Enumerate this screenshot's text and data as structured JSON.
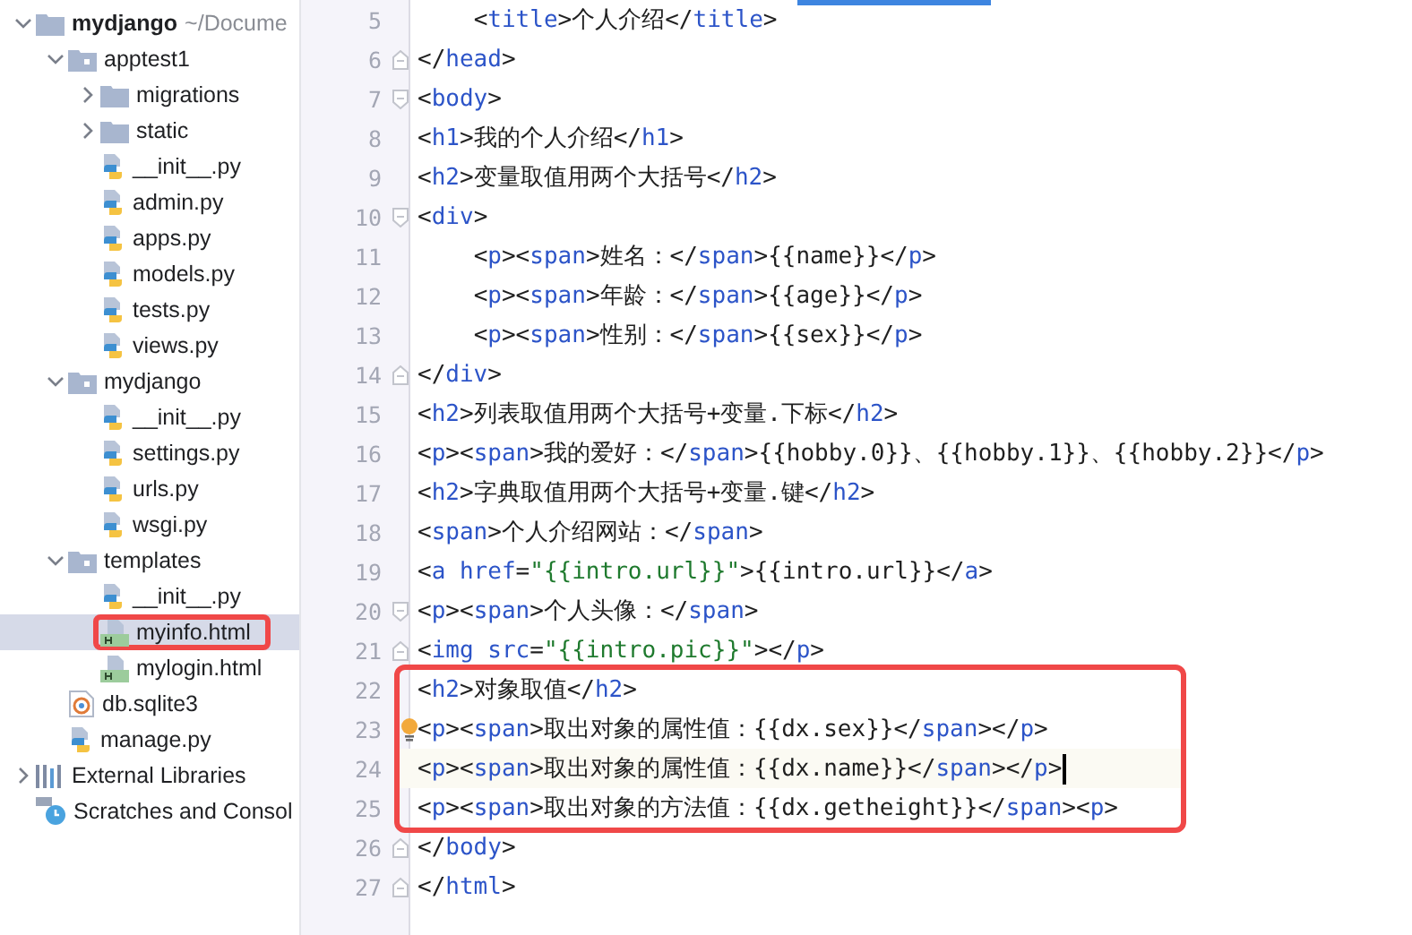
{
  "project_tree": [
    {
      "kind": "folder",
      "label": "mydjango",
      "hint": "~/Docume",
      "expanded": true,
      "selected": false,
      "children": [
        {
          "kind": "module-folder",
          "label": "apptest1",
          "expanded": true,
          "selected": false,
          "children": [
            {
              "kind": "folder",
              "label": "migrations",
              "expanded": false,
              "selected": false
            },
            {
              "kind": "folder",
              "label": "static",
              "expanded": false,
              "selected": false
            },
            {
              "kind": "python",
              "label": "__init__.py",
              "selected": false
            },
            {
              "kind": "python",
              "label": "admin.py",
              "selected": false
            },
            {
              "kind": "python",
              "label": "apps.py",
              "selected": false
            },
            {
              "kind": "python",
              "label": "models.py",
              "selected": false
            },
            {
              "kind": "python",
              "label": "tests.py",
              "selected": false
            },
            {
              "kind": "python",
              "label": "views.py",
              "selected": false
            }
          ]
        },
        {
          "kind": "module-folder",
          "label": "mydjango",
          "expanded": true,
          "selected": false,
          "children": [
            {
              "kind": "python",
              "label": "__init__.py",
              "selected": false
            },
            {
              "kind": "python",
              "label": "settings.py",
              "selected": false
            },
            {
              "kind": "python",
              "label": "urls.py",
              "selected": false
            },
            {
              "kind": "python",
              "label": "wsgi.py",
              "selected": false
            }
          ]
        },
        {
          "kind": "module-folder",
          "label": "templates",
          "expanded": true,
          "selected": false,
          "children": [
            {
              "kind": "python",
              "label": "__init__.py",
              "selected": false
            },
            {
              "kind": "html",
              "label": "myinfo.html",
              "selected": true,
              "boxed": true
            },
            {
              "kind": "html",
              "label": "mylogin.html",
              "selected": false
            }
          ]
        },
        {
          "kind": "database",
          "label": "db.sqlite3",
          "selected": false
        },
        {
          "kind": "python",
          "label": "manage.py",
          "selected": false
        }
      ]
    },
    {
      "kind": "libraries",
      "label": "External Libraries",
      "expanded": false,
      "selected": false
    },
    {
      "kind": "scratches",
      "label": "Scratches and Consol",
      "selected": false
    }
  ],
  "editor": {
    "lines": [
      {
        "number": "5",
        "text": "    <title>个人介绍</title>"
      },
      {
        "number": "6",
        "text": "</head>",
        "fold_close": true
      },
      {
        "number": "7",
        "text": "<body>",
        "fold_open": true
      },
      {
        "number": "8",
        "text": "<h1>我的个人介绍</h1>"
      },
      {
        "number": "9",
        "text": "<h2>变量取值用两个大括号</h2>"
      },
      {
        "number": "10",
        "text": "<div>",
        "fold_open": true
      },
      {
        "number": "11",
        "text": "    <p><span>姓名：</span>{{name}}</p>"
      },
      {
        "number": "12",
        "text": "    <p><span>年龄：</span>{{age}}</p>"
      },
      {
        "number": "13",
        "text": "    <p><span>性别：</span>{{sex}}</p>"
      },
      {
        "number": "14",
        "text": "</div>",
        "fold_close": true
      },
      {
        "number": "15",
        "text": "<h2>列表取值用两个大括号+变量.下标</h2>"
      },
      {
        "number": "16",
        "text": "<p><span>我的爱好：</span>{{hobby.0}}、{{hobby.1}}、{{hobby.2}}</p>"
      },
      {
        "number": "17",
        "text": "<h2>字典取值用两个大括号+变量.键</h2>"
      },
      {
        "number": "18",
        "text": "<span>个人介绍网站：</span>"
      },
      {
        "number": "19",
        "text": "<a href=\"{{intro.url}}\">{{intro.url}}</a>"
      },
      {
        "number": "20",
        "text": "<p><span>个人头像：</span>",
        "fold_open": true
      },
      {
        "number": "21",
        "text": "<img src=\"{{intro.pic}}\"></p>",
        "fold_close": true
      },
      {
        "number": "22",
        "text": "<h2>对象取值</h2>",
        "boxed": true
      },
      {
        "number": "23",
        "text": "<p><span>取出对象的属性值：{{dx.sex}}</span></p>",
        "boxed": true,
        "bulb": true
      },
      {
        "number": "24",
        "text": "<p><span>取出对象的属性值：{{dx.name}}</span></p>",
        "boxed": true,
        "current": true
      },
      {
        "number": "25",
        "text": "<p><span>取出对象的方法值：{{dx.getheight}}</span><p>",
        "boxed": true
      },
      {
        "number": "26",
        "text": "</body>",
        "fold_close": true
      },
      {
        "number": "27",
        "text": "</html>",
        "fold_close": true
      }
    ]
  }
}
